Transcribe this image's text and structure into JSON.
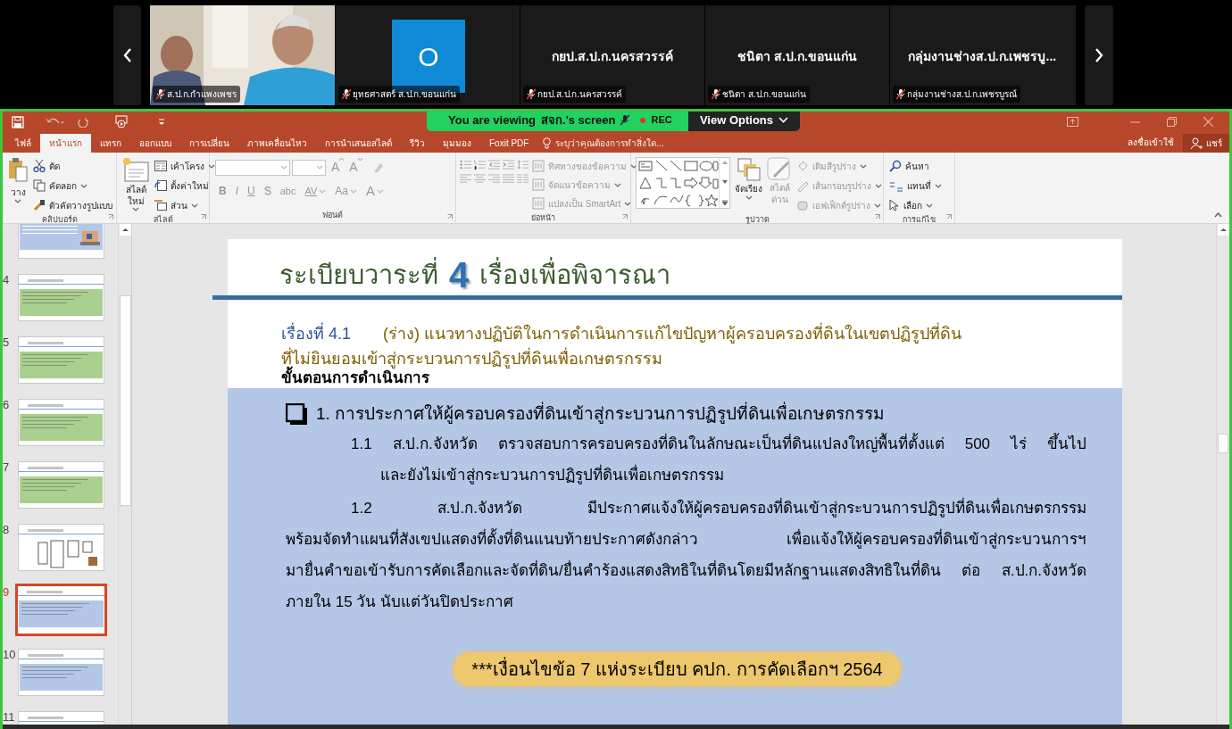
{
  "meeting": {
    "tiles": [
      {
        "kind": "video",
        "label": "ส.ป.ก.กำแพงเพชร",
        "muted": true
      },
      {
        "kind": "avatar",
        "letter": "O",
        "label": "ยุทธศาสตร์ ส.ป.ก.ขอนแก่น",
        "muted": true
      },
      {
        "kind": "name",
        "name": "กยป.ส.ป.ก.นครสวรรค์",
        "label": "กยป.ส.ป.ก.นครสวรรค์",
        "muted": true
      },
      {
        "kind": "name",
        "name": "ชนิตา ส.ป.ก.ขอนแก่น",
        "label": "ชนิตา ส.ป.ก.ขอนแก่น",
        "muted": true
      },
      {
        "kind": "name",
        "name": "กลุ่มงานช่างส.ป.ก.เพชรบู...",
        "label": "กลุ่มงานช่างส.ป.ก.เพชรบูรณ์",
        "muted": true
      }
    ]
  },
  "share_banner": {
    "viewing": "You are viewing",
    "owner": "สจก.'s screen",
    "rec": "REC",
    "view_options": "View Options"
  },
  "tabs": [
    {
      "label": "ไฟล์",
      "selected": false
    },
    {
      "label": "หน้าแรก",
      "selected": true
    },
    {
      "label": "แทรก",
      "selected": false
    },
    {
      "label": "ออกแบบ",
      "selected": false
    },
    {
      "label": "การเปลี่ยน",
      "selected": false
    },
    {
      "label": "ภาพเคลื่อนไหว",
      "selected": false
    },
    {
      "label": "การนำเสนอสไลด์",
      "selected": false
    },
    {
      "label": "รีวิว",
      "selected": false
    },
    {
      "label": "มุมมอง",
      "selected": false
    },
    {
      "label": "Foxit PDF",
      "selected": false
    }
  ],
  "tell_me": "ระบุว่าคุณต้องการทำสิ่งใด...",
  "sign_in": "ลงชื่อเข้าใช้",
  "share": "แชร์",
  "ribbon": {
    "groups": [
      {
        "kind": "clipboard",
        "label": "คลิปบอร์ด",
        "paste": "วาง",
        "items": [
          "ตัด",
          "คัดลอก",
          "ตัวคัดวางรูปแบบ"
        ]
      },
      {
        "kind": "slides",
        "label": "สไลด์",
        "new_slide": [
          "สไลด์",
          "ใหม่"
        ],
        "items": [
          "เค้าโครง",
          "ตั้งค่าใหม่",
          "ส่วน"
        ]
      },
      {
        "kind": "font",
        "label": "ฟอนต์",
        "size_buttons": [
          "A",
          "A"
        ],
        "buttons": [
          "B",
          "I",
          "U",
          "S",
          "abc",
          "AV",
          "Aa",
          "A"
        ]
      },
      {
        "kind": "paragraph",
        "label": "ย่อหน้า",
        "items": [
          "ทิศทางของข้อความ",
          "จัดแนวข้อความ",
          "แปลงเป็น SmartArt"
        ]
      },
      {
        "kind": "drawing",
        "label": "รูปวาด",
        "arrange": "จัดเรียง",
        "quick_styles": [
          "สไตล์",
          "ด่วน"
        ],
        "items": [
          "เติมสีรูปร่าง",
          "เส้นกรอบรูปร่าง",
          "เอฟเฟ็กต์รูปร่าง"
        ]
      },
      {
        "kind": "editing",
        "label": "การแก้ไข",
        "items": [
          "ค้นหา",
          "แทนที่",
          "เลือก"
        ]
      }
    ]
  },
  "slides": [
    {
      "kind": "picture",
      "color": "#b4c7e7",
      "selected": false
    },
    {
      "number": "4",
      "kind": "block",
      "color": "#a9d08e",
      "selected": false
    },
    {
      "number": "5",
      "kind": "block",
      "color": "#a9d08e",
      "selected": false
    },
    {
      "number": "6",
      "kind": "block",
      "color": "#a9d08e",
      "selected": false
    },
    {
      "number": "7",
      "kind": "block",
      "color": "#a9d08e",
      "selected": false
    },
    {
      "number": "8",
      "kind": "boxes",
      "selected": false
    },
    {
      "number": "9",
      "kind": "block",
      "color": "#b4c7e7",
      "selected": true
    },
    {
      "number": "10",
      "kind": "block",
      "color": "#b4c7e7",
      "selected": false
    },
    {
      "number": "11",
      "kind": "header",
      "selected": false
    }
  ],
  "slide": {
    "title_prefix": "ระเบียบวาระที่",
    "title_number": "4",
    "title_suffix": "เรื่องเพื่อพิจารณา",
    "subject_label": "เรื่องที่ 4.1",
    "subject_lines": [
      "(ร่าง) แนวทางปฏิบัติในการดำเนินการแก้ไขปัญหาผู้ครอบครองที่ดินในเขตปฏิรูปที่ดิน",
      "ที่ไม่ยินยอมเข้าสู่กระบวนการปฏิรูปที่ดินเพื่อเกษตรกรรม"
    ],
    "section": "ขั้นตอนการดำเนินการ",
    "heading": "1. การประกาศให้ผู้ครอบครองที่ดินเข้าสู่กระบวนการปฏิรูปที่ดินเพื่อเกษตรกรรม",
    "items": [
      {
        "kind": "hanging",
        "lines": [
          "1.1 ส.ป.ก.จังหวัด ตรวจสอบการครอบครองที่ดินในลักษณะเป็นที่ดินแปลงใหญ่พื้นที่ตั้งแต่ 500 ไร่ ขึ้นไป",
          "และยังไม่เข้าสู่กระบวนการปฏิรูปที่ดินเพื่อเกษตรกรรม"
        ]
      },
      {
        "kind": "indented",
        "lines": [
          "1.2 ส.ป.ก.จังหวัด มีประกาศแจ้งให้ผู้ครอบครองที่ดินเข้าสู่กระบวนการปฏิรูปที่ดินเพื่อเกษตรกรรม",
          "พร้อมจัดทำแผนที่สังเขปแสดงที่ตั้งที่ดินแนบท้ายประกาศดังกล่าว เพื่อแจ้งให้ผู้ครอบครองที่ดินเข้าสู่กระบวนการฯ",
          "มายื่นคำขอเข้ารับการคัดเลือกและจัดที่ดิน/ยื่นคำร้องแสดงสิทธิในที่ดินโดยมีหลักฐานแสดงสิทธิในที่ดิน ต่อ ส.ป.ก.จังหวัด",
          "ภายใน 15 วัน นับแต่วันปิดประกาศ"
        ]
      }
    ],
    "note": "***เงื่อนไขข้อ 7 แห่งระเบียบ คปก. การคัดเลือกฯ 2564"
  }
}
